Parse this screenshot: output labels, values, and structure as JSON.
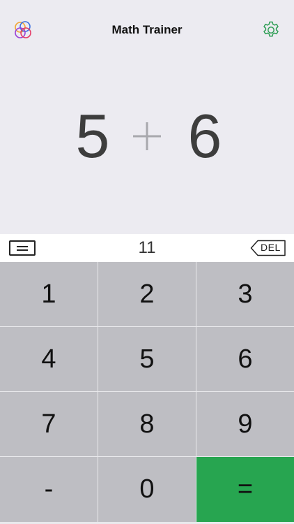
{
  "header": {
    "title": "Math Trainer",
    "logo_icon": "overlapping-circles-icon",
    "settings_icon": "gear-icon"
  },
  "problem": {
    "left": "5",
    "operator": "+",
    "right": "6"
  },
  "answer_bar": {
    "value": "11",
    "submit_icon": "equals-icon",
    "delete_label": "DEL"
  },
  "keypad": {
    "keys": [
      "1",
      "2",
      "3",
      "4",
      "5",
      "6",
      "7",
      "8",
      "9",
      "-",
      "0",
      "="
    ]
  },
  "colors": {
    "background": "#ECEBF1",
    "key": "#BEBEC3",
    "accent": "#27A550",
    "gear": "#2E9E55"
  }
}
